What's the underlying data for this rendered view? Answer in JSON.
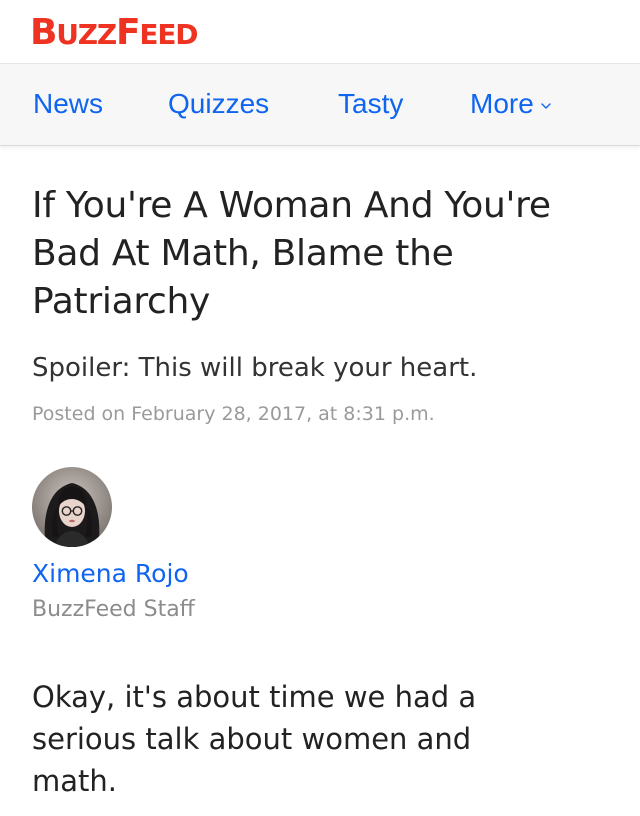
{
  "brand": {
    "logo_text": "BuzzFeed",
    "logo_color": "#ee3322"
  },
  "nav": {
    "items": [
      {
        "label": "News"
      },
      {
        "label": "Quizzes"
      },
      {
        "label": "Tasty"
      },
      {
        "label": "More",
        "icon": "chevron-down-icon"
      }
    ],
    "link_color": "#0f65ef"
  },
  "article": {
    "headline": "If You're A Woman And You're Bad At Math, Blame the Patriarchy",
    "dek": "Spoiler: This will break your heart.",
    "posted": "Posted on February 28, 2017, at 8:31 p.m.",
    "author": {
      "name": "Ximena Rojo",
      "title": "BuzzFeed Staff",
      "avatar_icon": "author-avatar"
    },
    "lede": "Okay, it's about time we had a serious talk about women and math."
  }
}
